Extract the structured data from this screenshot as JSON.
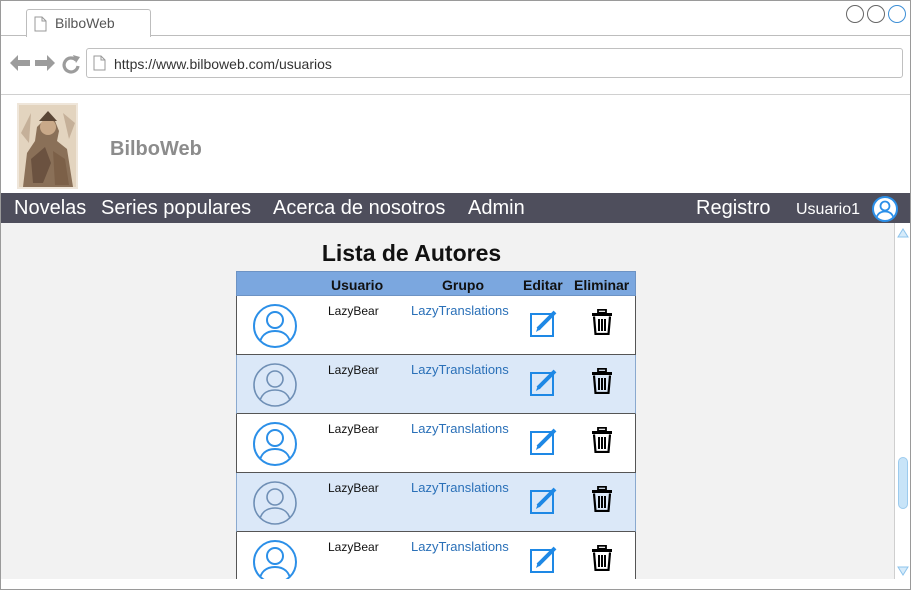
{
  "browser": {
    "tab_title": "BilboWeb",
    "url": "https://www.bilboweb.com/usuarios"
  },
  "site": {
    "brand": "BilboWeb"
  },
  "nav": {
    "items": [
      "Novelas",
      "Series populares",
      "Acerca de nosotros",
      "Admin"
    ],
    "register": "Registro",
    "user": "Usuario1"
  },
  "page": {
    "title": "Lista de Autores"
  },
  "table": {
    "headers": {
      "user": "Usuario",
      "group": "Grupo",
      "edit": "Editar",
      "delete": "Eliminar"
    },
    "rows": [
      {
        "user": "LazyBear",
        "group": "LazyTranslations"
      },
      {
        "user": "LazyBear",
        "group": "LazyTranslations"
      },
      {
        "user": "LazyBear",
        "group": "LazyTranslations"
      },
      {
        "user": "LazyBear",
        "group": "LazyTranslations"
      },
      {
        "user": "LazyBear",
        "group": "LazyTranslations"
      }
    ]
  },
  "colors": {
    "navbar": "#4e4e5c",
    "table_header": "#7ba7df",
    "row_alt": "#dbe8f8",
    "accent": "#2b8fe8",
    "link": "#2a70b8"
  },
  "icons": {
    "tab": "document-icon",
    "back": "arrow-left-icon",
    "forward": "arrow-right-icon",
    "reload": "reload-icon",
    "avatar": "user-avatar-icon",
    "edit": "edit-icon",
    "delete": "trash-icon"
  }
}
